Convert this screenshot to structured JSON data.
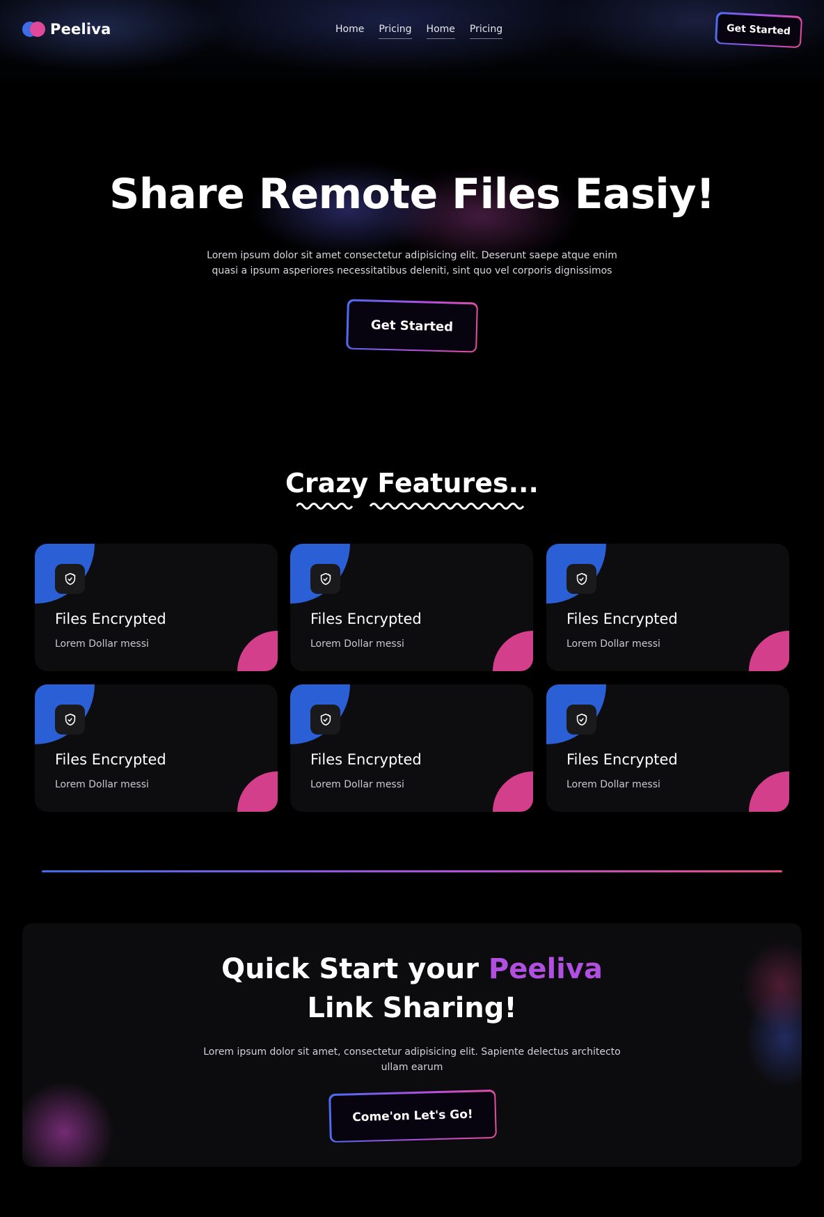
{
  "brand": {
    "name": "Peeliva"
  },
  "nav": {
    "items": [
      {
        "label": "Home"
      },
      {
        "label": "Pricing"
      },
      {
        "label": "Home"
      },
      {
        "label": "Pricing"
      }
    ],
    "cta_label": "Get Started"
  },
  "hero": {
    "title": "Share Remote Files Easiy!",
    "subtitle": "Lorem ipsum dolor sit amet consectetur adipisicing elit. Deserunt saepe atque enim quasi a ipsum asperiores necessitatibus deleniti, sint quo vel corporis dignissimos",
    "cta_label": "Get Started"
  },
  "features": {
    "title": "Crazy Features...",
    "cards": [
      {
        "icon": "shield-edit-icon",
        "title": "Files Encrypted",
        "desc": "Lorem Dollar messi"
      },
      {
        "icon": "shield-edit-icon",
        "title": "Files Encrypted",
        "desc": "Lorem Dollar messi"
      },
      {
        "icon": "shield-edit-icon",
        "title": "Files Encrypted",
        "desc": "Lorem Dollar messi"
      },
      {
        "icon": "shield-edit-icon",
        "title": "Files Encrypted",
        "desc": "Lorem Dollar messi"
      },
      {
        "icon": "shield-edit-icon",
        "title": "Files Encrypted",
        "desc": "Lorem Dollar messi"
      },
      {
        "icon": "shield-edit-icon",
        "title": "Files Encrypted",
        "desc": "Lorem Dollar messi"
      }
    ]
  },
  "cta": {
    "title_before": "Quick Start your ",
    "title_accent": "Peeliva",
    "title_after": " Link Sharing!",
    "subtitle": "Lorem ipsum dolor sit amet, consectetur adipisicing elit. Sapiente delectus architecto ullam earum",
    "button_label": "Come'on Let's Go!"
  },
  "colors": {
    "brand_blue": "#3d6ee6",
    "brand_pink": "#e0489a",
    "accent_purple": "#b04fe0",
    "card_background": "#0d0d0f"
  }
}
